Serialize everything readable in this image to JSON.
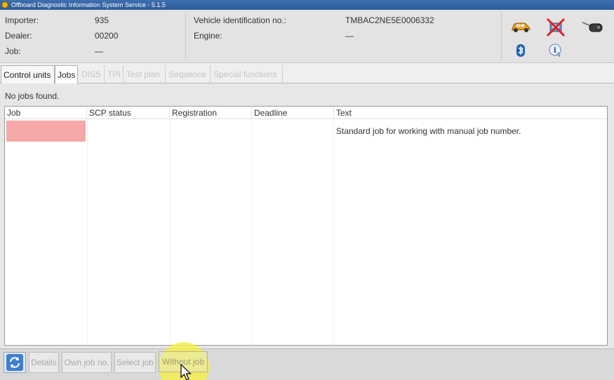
{
  "window": {
    "title": "Offboard Diagnostic Information System Service - 5.1.5"
  },
  "info": {
    "importer_label": "Importer:",
    "importer_value": "935",
    "dealer_label": "Dealer:",
    "dealer_value": "00200",
    "job_label": "Job:",
    "job_value": "—",
    "vin_label": "Vehicle identification no.:",
    "vin_value": "TMBAC2NE5E0006332",
    "engine_label": "Engine:",
    "engine_value": "—"
  },
  "status_icons": [
    "car-icon",
    "disconnected-vehicle-icon",
    "key-icon",
    "bluetooth-icon",
    "info-icon"
  ],
  "tabs": [
    {
      "label": "Control units",
      "enabled": true
    },
    {
      "label": "Jobs",
      "enabled": true
    },
    {
      "label": "DISS",
      "enabled": false
    },
    {
      "label": "TPI",
      "enabled": false
    },
    {
      "label": "Test plan",
      "enabled": false
    },
    {
      "label": "Sequence",
      "enabled": false
    },
    {
      "label": "Special functions",
      "enabled": false
    }
  ],
  "jobs": {
    "status_message": "No jobs found.",
    "columns": [
      "Job",
      "SCP status",
      "Registration",
      "Deadline",
      "Text"
    ],
    "rows": [
      {
        "job": "",
        "scp_status": "",
        "registration": "",
        "deadline": "",
        "text": "Standard job for working with manual job number."
      }
    ]
  },
  "buttons": {
    "details": "Details",
    "own_job_no": "Own job no.",
    "select_job": "Select job",
    "without_job": "Without job"
  },
  "colors": {
    "selection": "#f4a8a8",
    "click_highlight": "#f5f03c",
    "title_bar": "#3d6fb0"
  }
}
